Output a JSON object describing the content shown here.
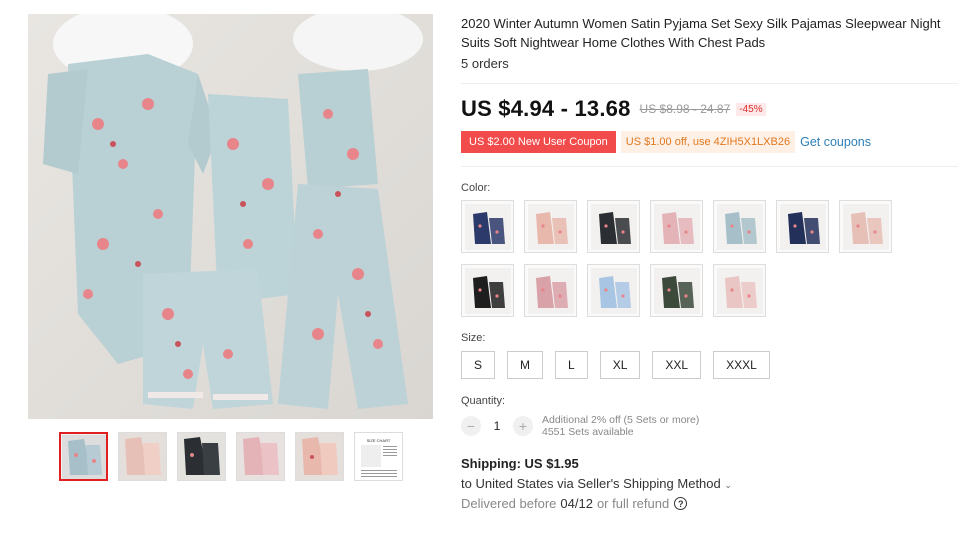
{
  "product": {
    "title": "2020 Winter Autumn Women Satin Pyjama Set Sexy Silk Pajamas Sleepwear Night Suits Soft Nightwear Home Clothes With Chest Pads",
    "orders": "5 orders"
  },
  "price": {
    "current": "US $4.94 - 13.68",
    "original": "US $8.98 - 24.87",
    "discount": "-45%"
  },
  "coupons": {
    "new_user": "US $2.00 New User Coupon",
    "store": "US $1.00 off, use 4ZIH5X1LXB26",
    "get_coupons": "Get coupons"
  },
  "color": {
    "label": "Color:",
    "options": [
      {
        "name": "navy floral",
        "color": "#2c3a6b"
      },
      {
        "name": "pink lace",
        "color": "#e8b8ad"
      },
      {
        "name": "black floral",
        "color": "#2b2f33"
      },
      {
        "name": "pink floral",
        "color": "#e3b3b8"
      },
      {
        "name": "light blue",
        "color": "#a7bfc9"
      },
      {
        "name": "navy",
        "color": "#22305a"
      },
      {
        "name": "peach floral",
        "color": "#e6c0b6"
      },
      {
        "name": "black",
        "color": "#1e1e1e"
      },
      {
        "name": "rose",
        "color": "#d9a1a8"
      },
      {
        "name": "sky blue",
        "color": "#a8c6e4"
      },
      {
        "name": "dark green floral",
        "color": "#3c4a3c"
      },
      {
        "name": "blush floral",
        "color": "#e9c5c3"
      }
    ]
  },
  "size": {
    "label": "Size:",
    "options": [
      "S",
      "M",
      "L",
      "XL",
      "XXL",
      "XXXL"
    ]
  },
  "quantity": {
    "label": "Quantity:",
    "value": "1",
    "minus": "−",
    "plus": "+",
    "note_line1": "Additional 2% off (5 Sets or more)",
    "note_line2": "4551 Sets available"
  },
  "shipping": {
    "title": "Shipping: US $1.95",
    "destination": "to United States via Seller's Shipping Method",
    "delivered_prefix": "Delivered before",
    "delivered_date": "04/12",
    "delivered_suffix": "or full refund",
    "help_icon": "?"
  },
  "thumbnails": {
    "count": 6,
    "size_chart_label": "SIZE CHART",
    "colors": [
      "#a7bfc9",
      "#e6c0b6",
      "#2b2f33",
      "#e3b3b8",
      "#e8b8ad",
      "#ffffff"
    ]
  }
}
